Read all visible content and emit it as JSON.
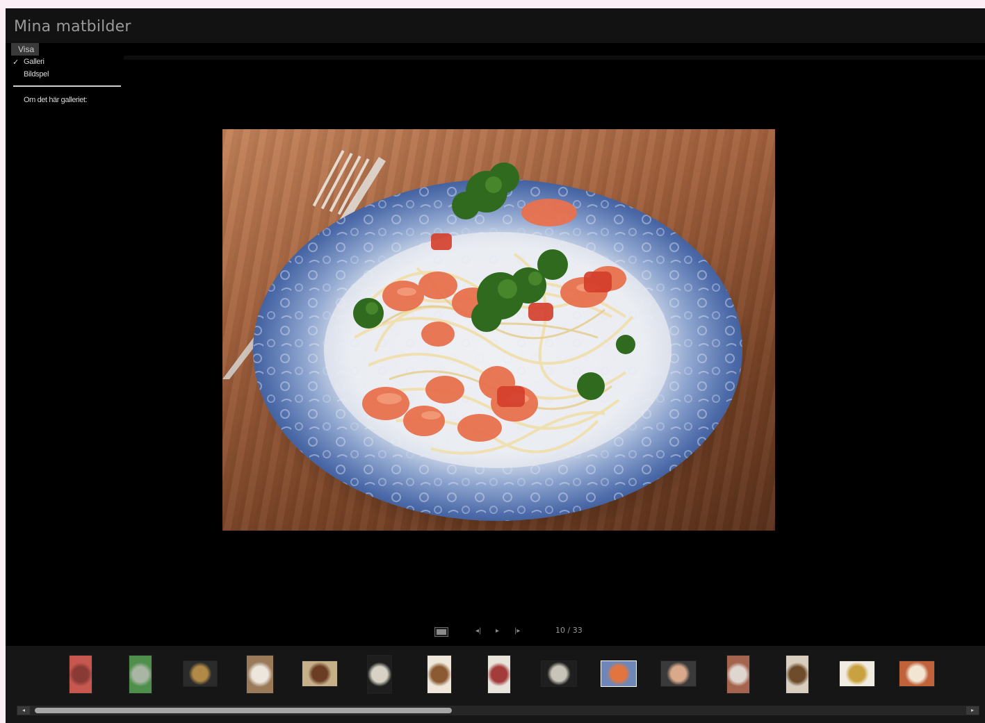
{
  "app": {
    "title": "Mina matbilder"
  },
  "menu": {
    "header_label": "Visa",
    "items": [
      {
        "label": "Galleri",
        "checked": true
      },
      {
        "label": "Bildspel",
        "checked": false
      }
    ],
    "about_label": "Om det här galleriet:"
  },
  "photo": {
    "subject": "spaghetti with shrimp, tomato and parsley on a blue floral plate"
  },
  "controls": {
    "counter": "10 / 33",
    "icons": {
      "fullscreen": "fullscreen-icon",
      "previous": "previous-icon",
      "play": "play-icon",
      "next": "next-icon"
    }
  },
  "filmstrip": {
    "thumbnail_count": 15,
    "selected_index": 9
  },
  "scrollbar": {
    "position": 0.45
  },
  "colors": {
    "background": "#000000",
    "titlebar": "#121212",
    "filmstrip": "#161616",
    "page": "#fbeef4"
  }
}
